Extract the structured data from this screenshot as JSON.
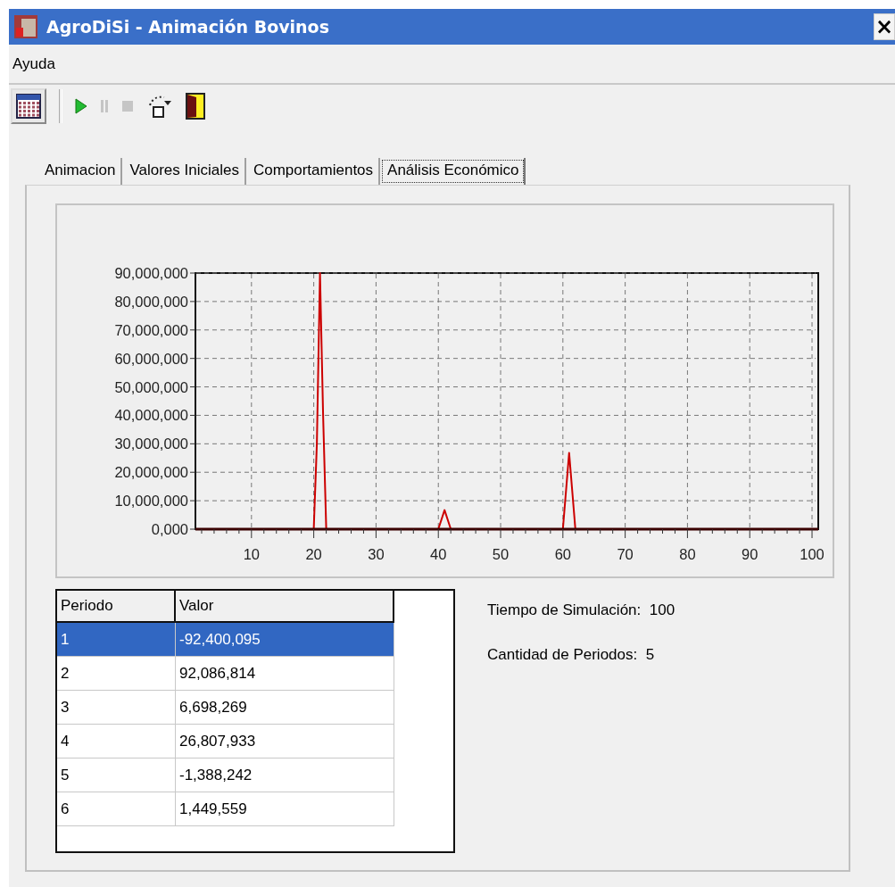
{
  "window": {
    "title": "AgroDiSi  - Animación Bovinos",
    "close": "×"
  },
  "menu": [
    "Ayuda"
  ],
  "toolbar": [
    {
      "kind": "calendar",
      "disabled": false
    },
    {
      "kind": "play",
      "disabled": false
    },
    {
      "kind": "pause",
      "disabled": true
    },
    {
      "kind": "stop",
      "disabled": true
    },
    {
      "kind": "reset",
      "disabled": false
    },
    {
      "kind": "exit",
      "disabled": false
    }
  ],
  "tabs": [
    {
      "label": "Animacion",
      "selected": false
    },
    {
      "label": "Valores Iniciales",
      "selected": false
    },
    {
      "label": "Comportamientos",
      "selected": false
    },
    {
      "label": "Análisis Económico",
      "selected": true
    }
  ],
  "chart": {
    "chart_data": {
      "type": "line",
      "x": [
        2,
        20,
        20.5,
        21,
        21.5,
        22,
        40,
        41,
        42,
        60,
        61,
        62,
        100
      ],
      "grid": true,
      "series": [
        {
          "color": "#cc0000",
          "values": [
            0,
            0,
            30000000,
            90000000,
            40000000,
            0,
            0,
            6700000,
            0,
            0,
            26800000,
            0,
            0
          ]
        }
      ],
      "xlim": [
        1,
        101
      ],
      "ylim": [
        0,
        90000000
      ],
      "xticks": [
        10,
        20,
        30,
        40,
        50,
        60,
        70,
        80,
        90,
        100
      ],
      "yticks": [
        {
          "value": 0,
          "label": "0,000"
        },
        {
          "value": 10000000,
          "label": "10,000,000"
        },
        {
          "value": 20000000,
          "label": "20,000,000"
        },
        {
          "value": 30000000,
          "label": "30,000,000"
        },
        {
          "value": 40000000,
          "label": "40,000,000"
        },
        {
          "value": 50000000,
          "label": "50,000,000"
        },
        {
          "value": 60000000,
          "label": "60,000,000"
        },
        {
          "value": 70000000,
          "label": "70,000,000"
        },
        {
          "value": 80000000,
          "label": "80,000,000"
        },
        {
          "value": 90000000,
          "label": "90,000,000"
        }
      ]
    }
  },
  "table": {
    "columns": [
      "Periodo",
      "Valor"
    ],
    "rows": [
      {
        "cells": [
          "1",
          "-92,400,095"
        ],
        "selected": true
      },
      {
        "cells": [
          "2",
          "92,086,814"
        ],
        "selected": false
      },
      {
        "cells": [
          "3",
          "6,698,269"
        ],
        "selected": false
      },
      {
        "cells": [
          "4",
          "26,807,933"
        ],
        "selected": false
      },
      {
        "cells": [
          "5",
          "-1,388,242"
        ],
        "selected": false
      },
      {
        "cells": [
          "6",
          "1,449,559"
        ],
        "selected": false
      }
    ]
  },
  "info": [
    {
      "label": "Tiempo de Simulación:",
      "value": "100"
    },
    {
      "label": "Cantidad de Periodos:",
      "value": "5"
    }
  ]
}
